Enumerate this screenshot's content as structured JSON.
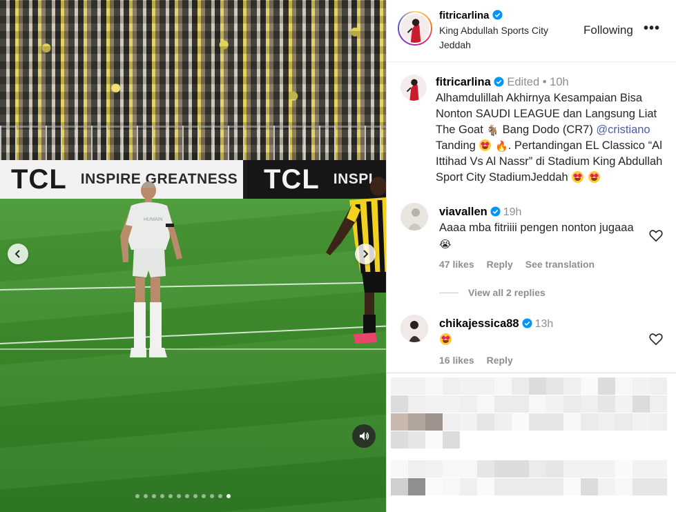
{
  "media": {
    "ad_left": {
      "brand": "TCL",
      "slogan": "INSPIRE GREATNESS"
    },
    "ad_right": {
      "brand": "TCL",
      "slogan": "INSPI"
    },
    "carousel": {
      "total": 12,
      "active_index": 11
    },
    "icons": {
      "prev": "chevron-left-icon",
      "next": "chevron-right-icon",
      "sound": "speaker-icon"
    }
  },
  "post_header": {
    "username": "fitricarlina",
    "location_line1": "King Abdullah Sports City",
    "location_line2": "Jeddah",
    "follow_label": "Following",
    "more_label": "•••"
  },
  "caption": {
    "username": "fitricarlina",
    "edited": "Edited",
    "separator": "•",
    "time": "10h",
    "text_1": "Alhamdulillah Akhirnya Kesampaian Bisa Nonton SAUDI LEAGUE dan Langsung Liat The Goat",
    "goat_emoji": "🐐",
    "text_2": "Bang Dodo (CR7)",
    "mention": "@cristiano",
    "text_3": "Tanding",
    "fire_emoji": "🔥",
    "text_4": ". Pertandingan EL Classico “Al Ittihad Vs Al Nassr” di Stadium King Abdullah Sport City StadiumJeddah"
  },
  "comments": [
    {
      "username": "viavallen",
      "time": "19h",
      "text": "Aaaa mba fitriiii pengen nonton jugaaa",
      "emoji": "😭",
      "likes": "47 likes",
      "reply": "Reply",
      "translate": "See translation"
    },
    {
      "username": "chikajessica88",
      "time": "13h",
      "likes": "16 likes",
      "reply": "Reply"
    }
  ],
  "view_replies": "View all 2 replies",
  "colors": {
    "accent_link": "#4a5ea8",
    "verified_blue": "#0095f6",
    "muted_text": "#8e8e8e",
    "divider": "#dbdbdb"
  }
}
